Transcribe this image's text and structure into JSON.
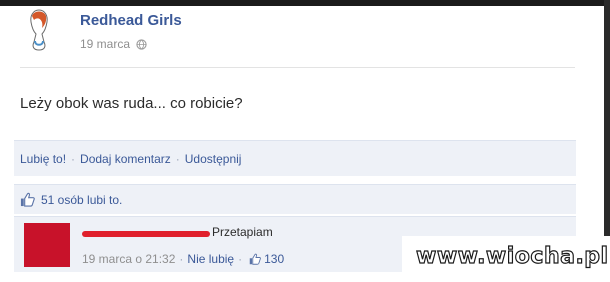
{
  "post": {
    "author": "Redhead Girls",
    "date": "19 marca",
    "message": "Leży obok was ruda... co robicie?"
  },
  "actions": {
    "like": "Lubię to!",
    "comment": "Dodaj komentarz",
    "share": "Udostępnij"
  },
  "likes": {
    "text": "51 osób lubi to."
  },
  "comment": {
    "text": "Przetapiam",
    "time": "19 marca o 21:32",
    "unlike": "Nie lubię",
    "like_count": "130"
  },
  "watermark": "www.wiocha.pl",
  "colors": {
    "link": "#3b5998",
    "panel": "#eef1f7",
    "redaction": "#e0202c"
  }
}
